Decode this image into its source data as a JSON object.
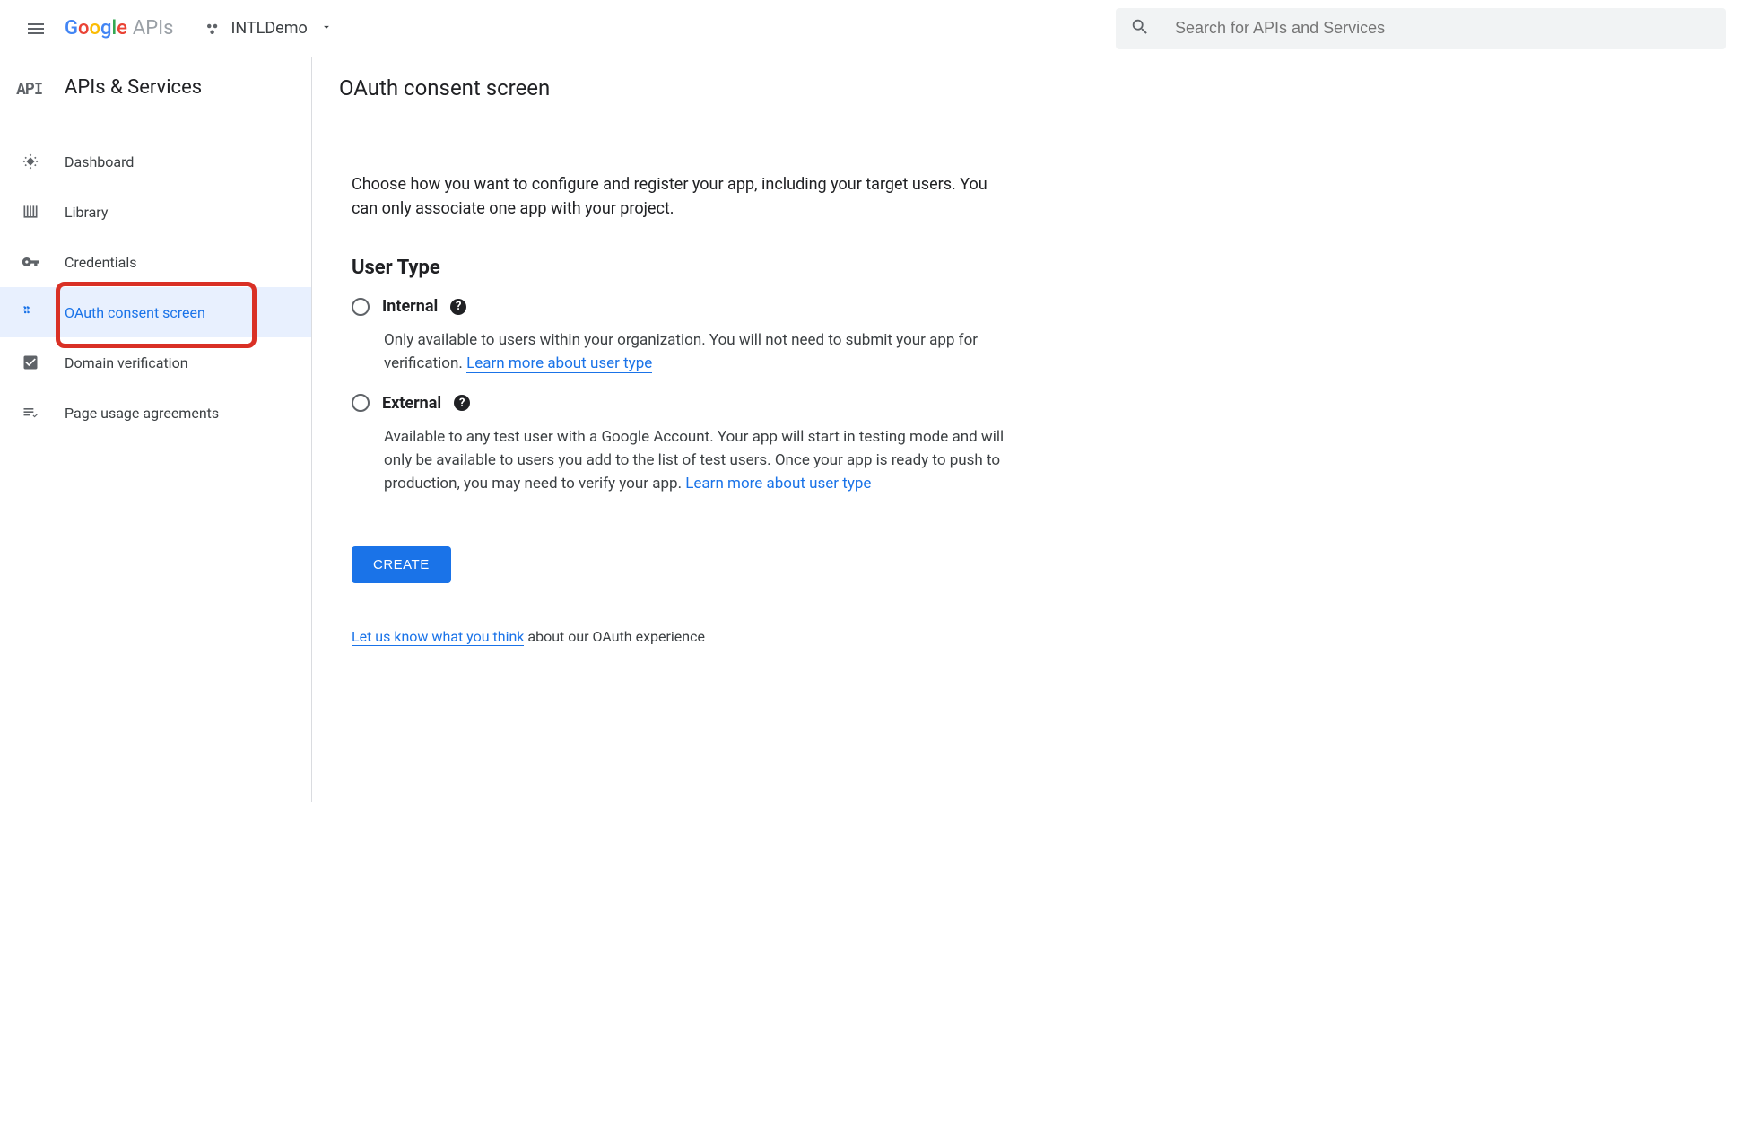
{
  "header": {
    "logo_apis": "APIs",
    "project_name": "INTLDemo",
    "search_placeholder": "Search for APIs and Services"
  },
  "sidebar": {
    "api_abbrev": "API",
    "title": "APIs & Services",
    "items": [
      {
        "label": "Dashboard"
      },
      {
        "label": "Library"
      },
      {
        "label": "Credentials"
      },
      {
        "label": "OAuth consent screen"
      },
      {
        "label": "Domain verification"
      },
      {
        "label": "Page usage agreements"
      }
    ]
  },
  "main": {
    "title": "OAuth consent screen",
    "intro": "Choose how you want to configure and register your app, including your target users. You can only associate one app with your project.",
    "section_heading": "User Type",
    "options": [
      {
        "label": "Internal",
        "desc_pre": "Only available to users within your organization. You will not need to submit your app for verification. ",
        "link_text": "Learn more about user type"
      },
      {
        "label": "External",
        "desc_pre": "Available to any test user with a Google Account. Your app will start in testing mode and will only be available to users you add to the list of test users. Once your app is ready to push to production, you may need to verify your app. ",
        "link_text": "Learn more about user type"
      }
    ],
    "create_button": "CREATE",
    "feedback_link": "Let us know what you think",
    "feedback_rest": " about our OAuth experience"
  }
}
